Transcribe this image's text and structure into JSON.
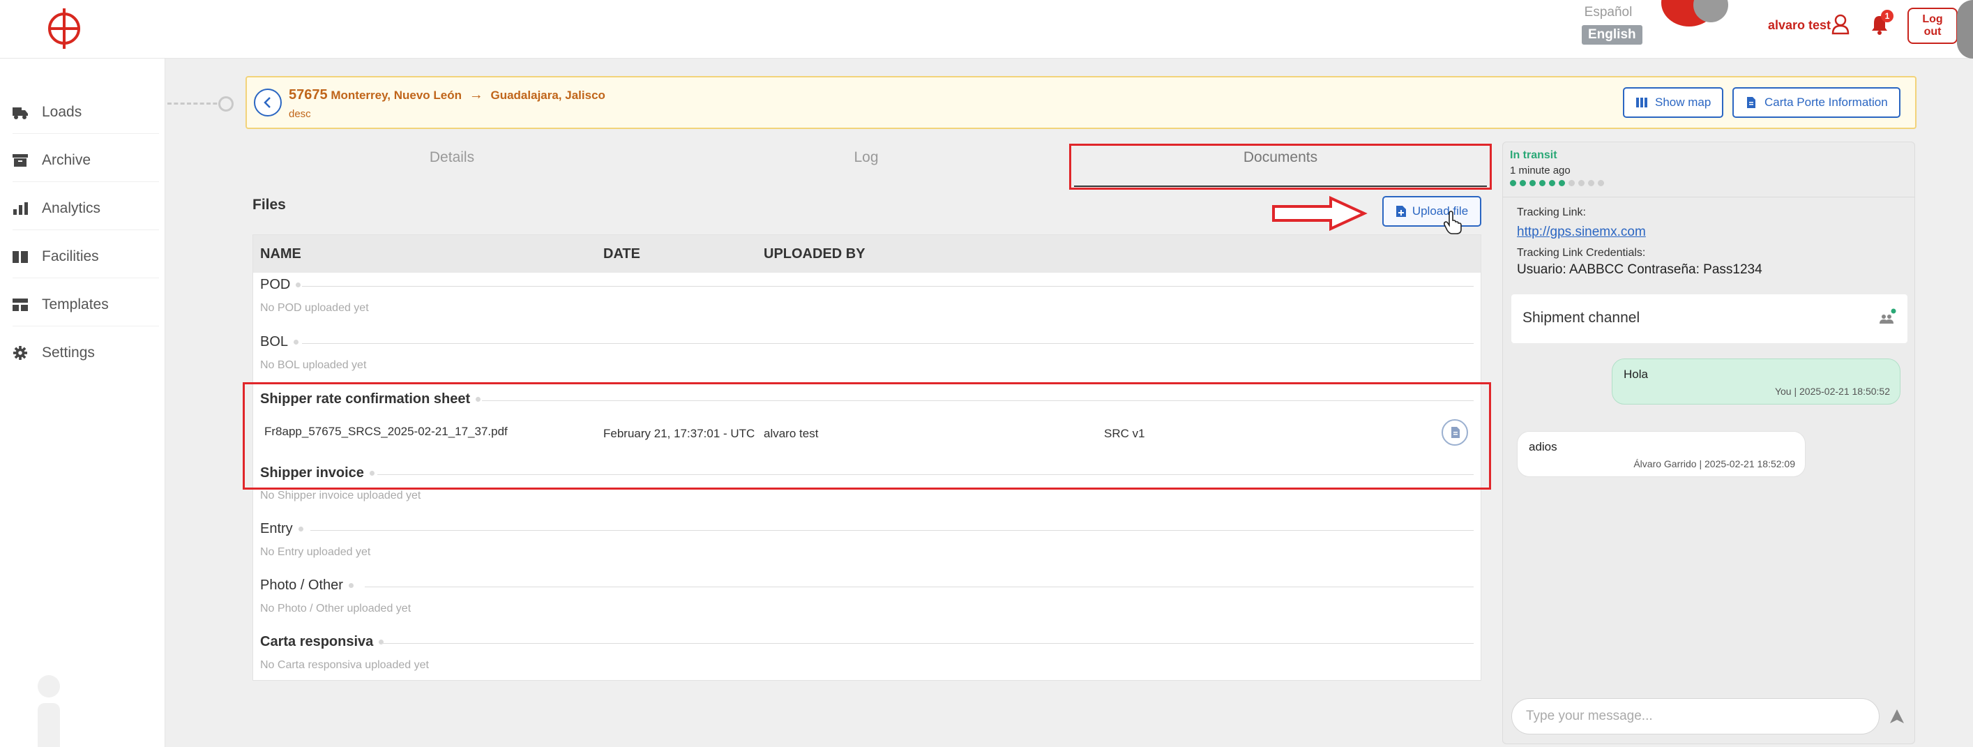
{
  "header": {
    "language_options": [
      "Español",
      "English"
    ],
    "selected_language": "English",
    "user_name": "alvaro test",
    "notification_count": "1",
    "logout_label_line1": "Log",
    "logout_label_line2": "out"
  },
  "sidebar": {
    "items": [
      {
        "label": "Loads",
        "icon": "truck-icon"
      },
      {
        "label": "Archive",
        "icon": "archive-icon"
      },
      {
        "label": "Analytics",
        "icon": "bar-chart-icon"
      },
      {
        "label": "Facilities",
        "icon": "warehouse-icon"
      },
      {
        "label": "Templates",
        "icon": "template-icon"
      },
      {
        "label": "Settings",
        "icon": "gear-icon"
      }
    ]
  },
  "load": {
    "id": "57675",
    "origin": "Monterrey, Nuevo León",
    "destination": "Guadalajara, Jalisco",
    "description": "desc",
    "show_map_label": "Show map",
    "carta_porte_label": "Carta Porte Information"
  },
  "tabs": {
    "details": "Details",
    "log": "Log",
    "documents": "Documents",
    "active": "documents"
  },
  "files": {
    "title": "Files",
    "upload_label": "Upload file",
    "columns": {
      "name": "NAME",
      "date": "DATE",
      "uploaded_by": "UPLOADED BY"
    },
    "categories": [
      {
        "name": "POD",
        "empty_note": "No POD uploaded yet"
      },
      {
        "name": "BOL",
        "empty_note": "No BOL uploaded yet"
      },
      {
        "name": "Shipper rate confirmation sheet",
        "files": [
          {
            "file_name": "Fr8app_57675_SRCS_2025-02-21_17_37.pdf",
            "date": "February 21, 17:37:01 - UTC",
            "uploaded_by": "alvaro test",
            "tag": "SRC v1"
          }
        ]
      },
      {
        "name": "Shipper invoice",
        "empty_note": "No Shipper invoice uploaded yet"
      },
      {
        "name": "Entry",
        "empty_note": "No Entry uploaded yet"
      },
      {
        "name": "Photo / Other",
        "empty_note": "No Photo / Other uploaded yet"
      },
      {
        "name": "Carta responsiva",
        "empty_note": "No Carta responsiva uploaded yet"
      }
    ]
  },
  "tracking": {
    "status": "In transit",
    "updated": "1 minute ago",
    "progress_steps_total": 10,
    "progress_steps_done": 6,
    "link_label": "Tracking Link:",
    "link_url": "http://gps.sinemx.com",
    "credentials_label": "Tracking Link Credentials:",
    "credentials": "Usuario: AABBCC Contraseña: Pass1234"
  },
  "channel": {
    "title": "Shipment channel",
    "messages": [
      {
        "text": "Hola",
        "meta": "You | 2025-02-21 18:50:52",
        "mine": true
      },
      {
        "text": "adios",
        "meta": "Álvaro Garrido | 2025-02-21 18:52:09",
        "mine": false
      }
    ],
    "input_placeholder": "Type your message..."
  },
  "colors": {
    "brand_red": "#c8231c",
    "link_blue": "#2b66c2",
    "status_green": "#2aa876",
    "highlight_red": "#e0262a"
  }
}
